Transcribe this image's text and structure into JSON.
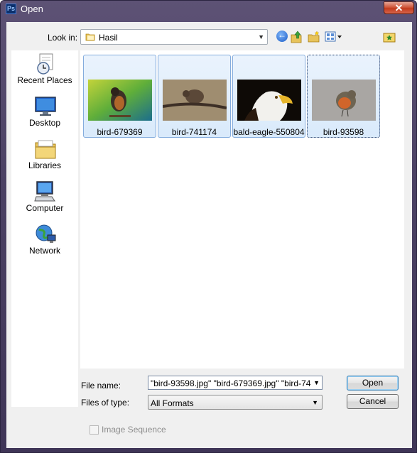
{
  "window": {
    "title": "Open",
    "app_icon": "Ps",
    "close_glyph": "✕"
  },
  "look_in": {
    "label": "Look in:",
    "value": "Hasil",
    "arrow": "▼"
  },
  "toolbar": {
    "back": "back-icon",
    "up": "up-folder-icon",
    "new_folder": "new-folder-icon",
    "views": "views-menu-icon",
    "desktop": "desktop-shortcut-icon"
  },
  "places": [
    {
      "label": "Recent Places",
      "icon": "recent-places-icon"
    },
    {
      "label": "Desktop",
      "icon": "desktop-icon"
    },
    {
      "label": "Libraries",
      "icon": "libraries-icon"
    },
    {
      "label": "Computer",
      "icon": "computer-icon"
    },
    {
      "label": "Network",
      "icon": "network-icon"
    }
  ],
  "files": [
    {
      "name": "bird-679369",
      "selected": true
    },
    {
      "name": "bird-741174",
      "selected": true
    },
    {
      "name": "bald-eagle-550804",
      "selected": true
    },
    {
      "name": "bird-93598",
      "selected": true,
      "focused": true
    }
  ],
  "file_name": {
    "label": "File name:",
    "value": "\"bird-93598.jpg\" \"bird-679369.jpg\" \"bird-741174",
    "arrow": "▼"
  },
  "file_type": {
    "label": "Files of type:",
    "value": "All Formats",
    "arrow": "▼"
  },
  "buttons": {
    "open": "Open",
    "cancel": "Cancel"
  },
  "image_sequence": {
    "label": "Image Sequence",
    "checked": false,
    "enabled": false
  },
  "colors": {
    "selection_fill": "#d9eafb",
    "selection_border": "#84acdd",
    "frame": "#4b4163"
  }
}
